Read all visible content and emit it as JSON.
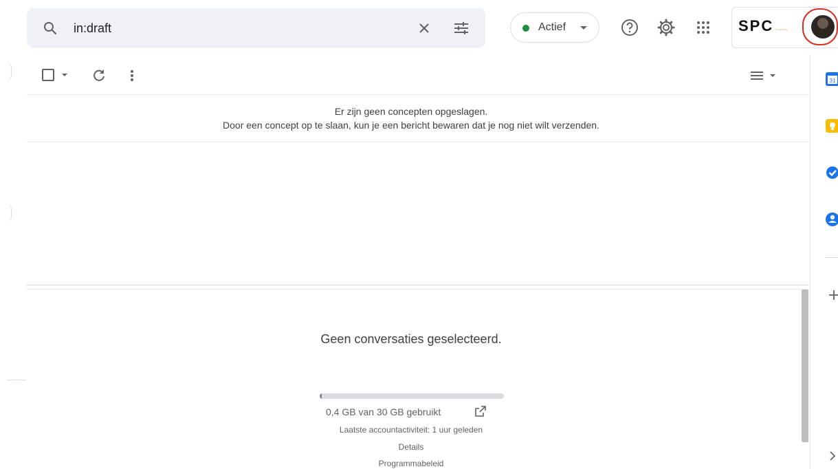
{
  "search": {
    "query": "in:draft",
    "icon": "search-icon",
    "clear_icon": "close-icon",
    "options_icon": "tune-icon"
  },
  "status": {
    "label": "Actief",
    "color": "#1e8e3e"
  },
  "header_icons": [
    "help-icon",
    "gear-icon",
    "apps-grid-icon"
  ],
  "brand": {
    "text": "SPC"
  },
  "toolbar": {
    "icons": [
      "checkbox-icon",
      "caret-down-icon",
      "refresh-icon",
      "more-vert-icon",
      "density-icon"
    ]
  },
  "list": {
    "empty_line1": "Er zijn geen concepten opgeslagen.",
    "empty_line2": "Door een concept op te slaan, kun je een bericht bewaren dat je nog niet wilt verzenden."
  },
  "reading_pane": {
    "no_selection": "Geen conversaties geselecteerd.",
    "storage_used_fraction": 0.013,
    "storage_text": "0,4 GB van 30 GB gebruikt",
    "last_activity": "Laatste accountactiviteit: 1 uur geleden",
    "details": "Details",
    "policy": "Programmabeleid"
  },
  "side_panel": {
    "apps": [
      "calendar-icon",
      "keep-icon",
      "tasks-icon",
      "contacts-icon"
    ],
    "add_icon": "plus-icon",
    "expand_icon": "chevron-right-icon",
    "colors": {
      "calendar": "#1a73e8",
      "keep": "#fbbc04",
      "tasks": "#1a73e8",
      "contacts": "#1a73e8"
    }
  }
}
